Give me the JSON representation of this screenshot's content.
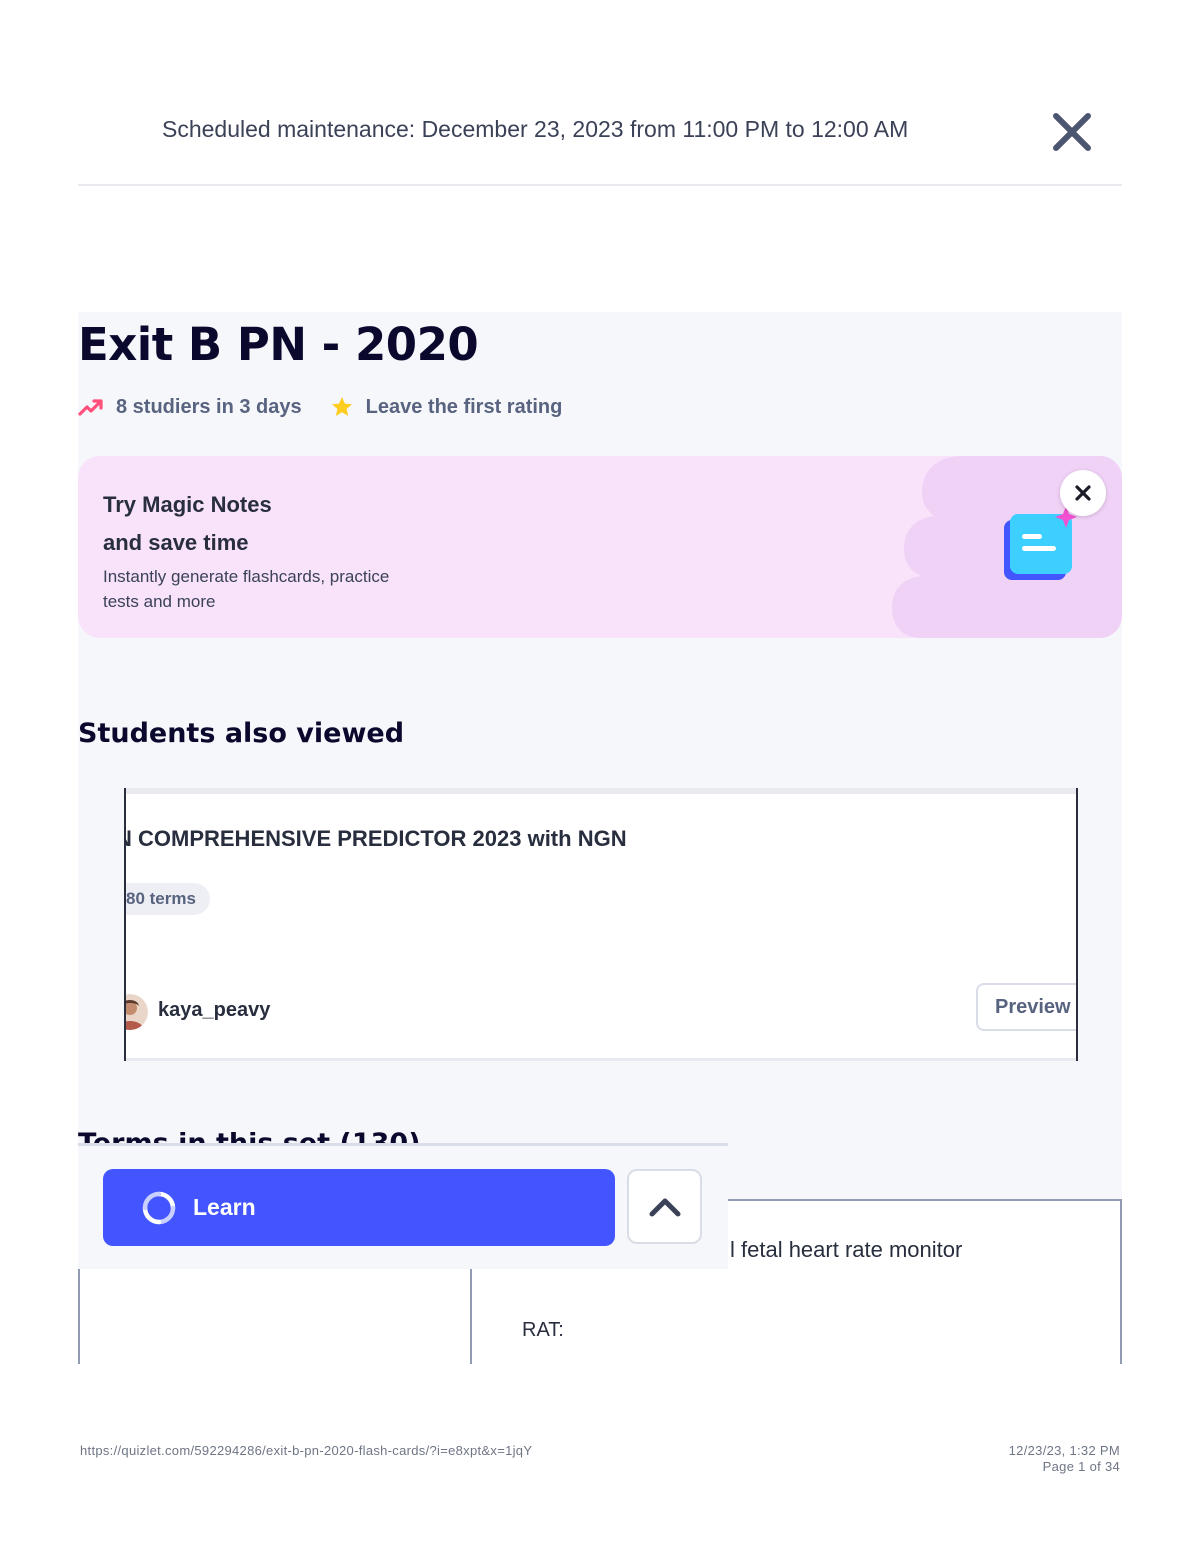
{
  "maintenance": {
    "text": "Scheduled maintenance: December 23, 2023 from 11:00 PM to 12:00 AM",
    "close_icon": "close-x-icon"
  },
  "set": {
    "title": "Exit B PN - 2020",
    "studiers": "8 studiers in 3 days",
    "rating": "Leave the first rating",
    "trend_icon": "trending-up-icon",
    "star_icon": "star-icon",
    "colors": {
      "trend": "#ff4f7a",
      "star": "#ffcd1f"
    }
  },
  "promo": {
    "title_line1": "Try Magic Notes",
    "title_line2": "and save time",
    "subtitle": "Instantly generate flashcards, practice tests and more",
    "icon": "magic-notes-icon",
    "close_icon": "close-x-icon",
    "colors": {
      "background": "#f8e3fb",
      "blob": "#f1d2f7"
    }
  },
  "students_also_viewed": {
    "heading": "Students also viewed",
    "cards": [
      {
        "title": "N COMPREHENSIVE PREDICTOR 2023 with NGN",
        "terms": "80 terms",
        "user": "kaya_peavy",
        "preview_label": "Preview"
      }
    ]
  },
  "terms_section": {
    "heading": "Terms in this set (130)",
    "rows": [
      {
        "term": "",
        "definition": "l fetal heart rate monitor",
        "note": "RAT:"
      }
    ]
  },
  "sticky_bar": {
    "learn_label": "Learn",
    "learn_icon": "learn-cycle-icon",
    "up_icon": "chevron-up-icon",
    "colors": {
      "learn": "#4255ff"
    }
  },
  "footer": {
    "url": "https://quizlet.com/592294286/exit-b-pn-2020-flash-cards/?i=e8xpt&x=1jqY",
    "datetime": "12/23/23, 1:32 PM",
    "page": "Page 1 of 34"
  }
}
